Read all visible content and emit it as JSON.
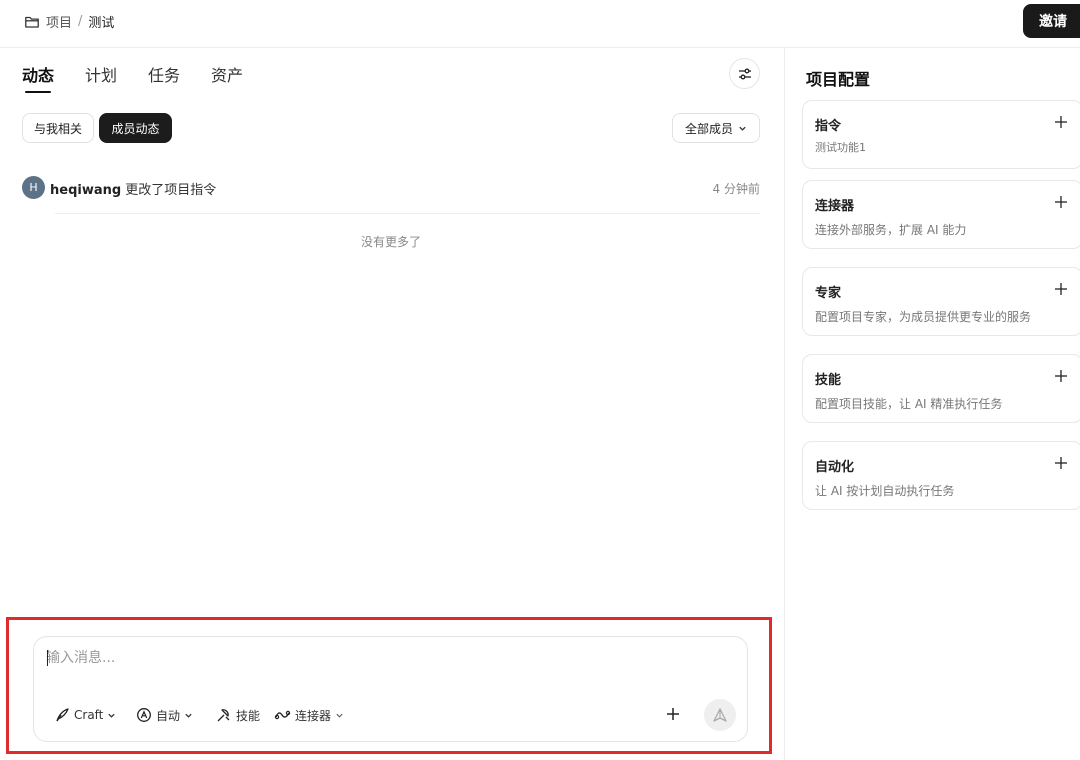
{
  "breadcrumb": {
    "project": "项目",
    "separator": "/",
    "current": "测试"
  },
  "header": {
    "invite_label": "邀请"
  },
  "tabs": [
    {
      "label": "动态",
      "active": true
    },
    {
      "label": "计划",
      "active": false
    },
    {
      "label": "任务",
      "active": false
    },
    {
      "label": "资产",
      "active": false
    }
  ],
  "filters": {
    "mine": "与我相关",
    "members": "成员动态",
    "members_select": "全部成员"
  },
  "activity": [
    {
      "avatar": "H",
      "user": "heqiwang",
      "action": "更改了项目指令",
      "time": "4 分钟前"
    }
  ],
  "no_more": "没有更多了",
  "composer": {
    "placeholder": "输入消息...",
    "tools": [
      {
        "label": "Craft",
        "icon": "craft-icon"
      },
      {
        "label": "自动",
        "icon": "auto-icon"
      },
      {
        "label": "技能",
        "icon": "skill-icon"
      },
      {
        "label": "连接器",
        "icon": "connector-icon"
      }
    ]
  },
  "right_panel": {
    "title": "项目配置",
    "cards": [
      {
        "title": "指令",
        "desc": "测试功能1"
      },
      {
        "title": "连接器",
        "desc": "连接外部服务，扩展 AI 能力"
      },
      {
        "title": "专家",
        "desc": "配置项目专家，为成员提供更专业的服务"
      },
      {
        "title": "技能",
        "desc": "配置项目技能，让 AI 精准执行任务"
      },
      {
        "title": "自动化",
        "desc": "让 AI 按计划自动执行任务"
      }
    ]
  },
  "colors": {
    "primary_dark": "#1a1a1a",
    "highlight_border": "#e02b2b",
    "avatar_bg": "#5b7287"
  }
}
